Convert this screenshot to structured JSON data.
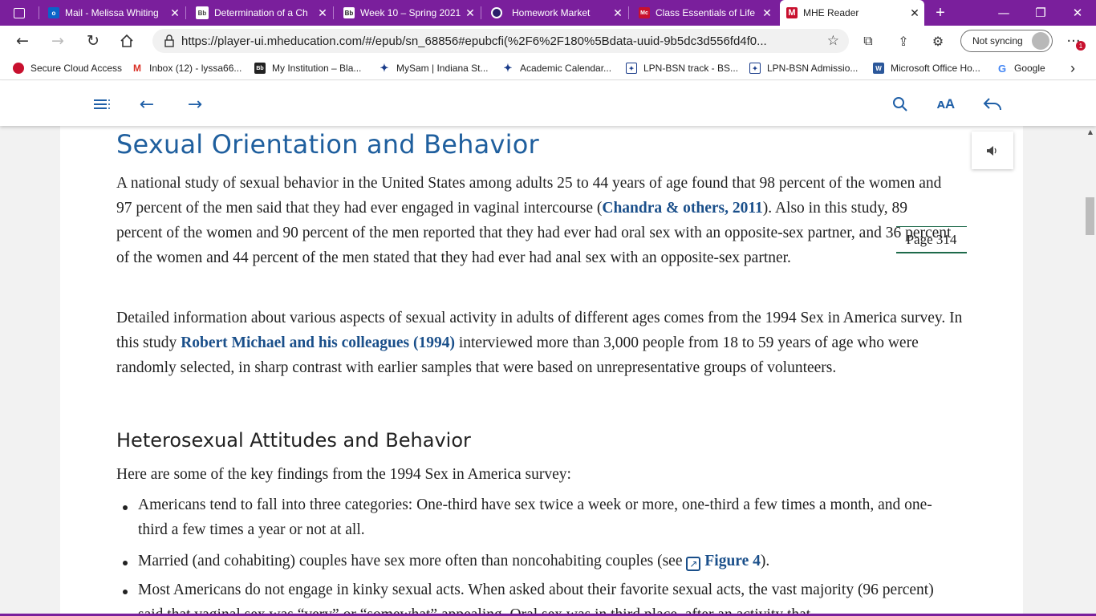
{
  "tabs": [
    {
      "title": "Mail - Melissa Whiting",
      "favicon_text": "o",
      "favicon_bg": "#0a64c8",
      "active": false
    },
    {
      "title": "Determination of a Ch",
      "favicon_text": "Bb",
      "favicon_bg": "#444444",
      "active": false
    },
    {
      "title": "Week 10 – Spring 2021",
      "favicon_text": "Bb",
      "favicon_bg": "#222222",
      "active": false
    },
    {
      "title": "Homework Market",
      "favicon_text": "",
      "favicon_bg": "#2a1f6b",
      "active": false
    },
    {
      "title": "Class Essentials of Life",
      "favicon_text": "Mc",
      "favicon_bg": "#c8102e",
      "active": false
    },
    {
      "title": "MHE Reader",
      "favicon_text": "M",
      "favicon_bg": "#c8102e",
      "active": true
    }
  ],
  "new_tab_symbol": "+",
  "window_controls": {
    "minimize": "—",
    "restore": "❐",
    "close": "✕"
  },
  "address": {
    "url": "https://player-ui.mheducation.com/#/epub/sn_68856#epubcfi(%2F6%2F180%5Bdata-uuid-9b5dc3d556fd4f0...",
    "sync_label": "Not syncing",
    "notification_count": "1"
  },
  "favorites": [
    {
      "label": "Secure Cloud Access",
      "icon": "cloud-icon",
      "color": "#c8102e"
    },
    {
      "label": "Inbox (12) - lyssa66...",
      "icon": "gmail-icon",
      "color": "#d93025"
    },
    {
      "label": "My Institution – Bla...",
      "icon": "blackboard-icon",
      "color": "#222222"
    },
    {
      "label": "MySam | Indiana St...",
      "icon": "star-logo-icon",
      "color": "#1a3c8a"
    },
    {
      "label": "Academic Calendar...",
      "icon": "star-logo-icon",
      "color": "#1a3c8a"
    },
    {
      "label": "LPN-BSN track - BS...",
      "icon": "bookmark-icon",
      "color": "#1a3c8a"
    },
    {
      "label": "LPN-BSN Admissio...",
      "icon": "bookmark-icon",
      "color": "#1a3c8a"
    },
    {
      "label": "Microsoft Office Ho...",
      "icon": "word-icon",
      "color": "#2b579a"
    },
    {
      "label": "Google",
      "icon": "google-icon",
      "color": "#4285f4"
    }
  ],
  "favorites_more": "›",
  "content": {
    "heading": "Sexual Orientation and Behavior",
    "p1": {
      "a": "A national study of sexual behavior in the United States among adults 25 to 44 years of age found that 98 percent of the women and 97 percent of the men said that they had ever engaged in vaginal intercourse (",
      "link": "Chandra & others, 2011",
      "b": "). Also in this study, 89 percent of the women and 90 percent of the men reported that they had ever had oral sex with an opposite-sex partner, and 36 percent of the women and 44 percent of the men stated that they had ever had anal sex with an opposite-sex partner."
    },
    "page_marker": "Page 314",
    "p2": {
      "a": "Detailed information about various aspects of sexual activity in adults of different ages comes from the 1994 Sex in America survey. In this study ",
      "link": "Robert Michael and his colleagues (1994)",
      "b": " interviewed more than 3,000 people from 18 to 59 years of age who were randomly selected, in sharp contrast with earlier samples that were based on unrepresentative groups of volunteers."
    },
    "subheading": "Heterosexual Attitudes and Behavior",
    "intro": "Here are some of the key findings from the 1994 Sex in America survey:",
    "bullets": [
      {
        "text": "Americans tend to fall into three categories: One-third have sex twice a week or more, one-third a few times a month, and one-third a few times a year or not at all."
      },
      {
        "text": "Married (and cohabiting) couples have sex more often than noncohabiting couples (see ",
        "link": "Figure 4",
        "tail": ")."
      },
      {
        "text": "Most Americans do not engage in kinky sexual acts. When asked about their favorite sexual acts, the vast majority (96 percent) said that vaginal sex was “very” or “somewhat” appealing. Oral sex was in third place, after an activity that"
      }
    ]
  },
  "accent_color": "#1f5fa7",
  "tabbar_color": "#7a1f9c"
}
